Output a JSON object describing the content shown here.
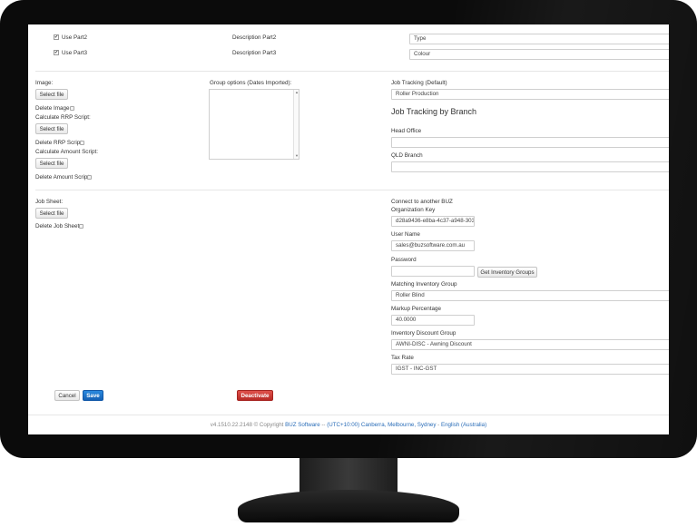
{
  "parts": {
    "use_part2": "Use Part2",
    "use_part3": "Use Part3",
    "desc_part2": "Description Part2",
    "desc_part3": "Description Part3",
    "part2_value": "Type",
    "part3_value": "Colour",
    "check_mark": "✔"
  },
  "left": {
    "image_label": "Image:",
    "select_file": "Select file",
    "delete_image": "Delete Image",
    "calc_rrp": "Calculate RRP Script:",
    "delete_rrp": "Delete RRP Script",
    "calc_amount": "Calculate Amount Script:",
    "delete_amount": "Delete Amount Script",
    "job_sheet": "Job Sheet:",
    "delete_job_sheet": "Delete Job Sheet"
  },
  "group_options": {
    "label": "Group options (Dates Imported):"
  },
  "job_tracking": {
    "label": "Job Tracking (Default)",
    "value": "Roller Production",
    "heading": "Job Tracking by Branch",
    "head_office": "Head Office",
    "qld_branch": "QLD Branch"
  },
  "connect": {
    "label": "Connect to another BUZ",
    "org_key_label": "Organization Key",
    "org_key_value": "d28a9436-e8ba-4c37-a948-3039",
    "user_name_label": "User Name",
    "user_name_value": "sales@buzsoftware.com.au",
    "password_label": "Password",
    "password_value": "",
    "get_groups": "Get Inventory Groups",
    "matching_label": "Matching Inventory Group",
    "matching_value": "Roller Blind",
    "markup_label": "Markup Percentage",
    "markup_value": "40.0000",
    "discount_label": "Inventory Discount Group",
    "discount_value": "AWNI-DISC - Awning Discount",
    "tax_label": "Tax Rate",
    "tax_value": "IGST - INC-GST"
  },
  "actions": {
    "cancel": "Cancel",
    "save": "Save",
    "deactivate": "Deactivate"
  },
  "footer": {
    "version": "v4.1510.22.2148 © Copyright",
    "company": "BUZ Software",
    "timezone": "(UTC+10:00) Canberra, Melbourne, Sydney",
    "separator": "--",
    "separator2": "-",
    "language": "English (Australia)"
  }
}
